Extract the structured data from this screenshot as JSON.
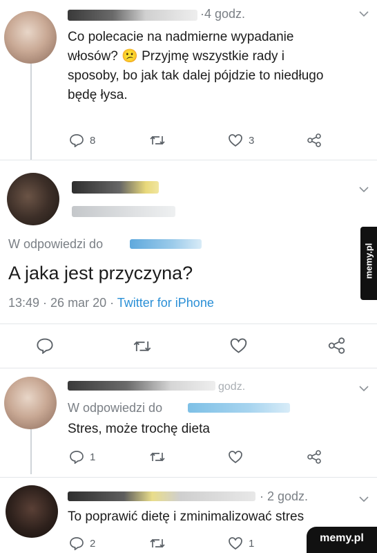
{
  "tweet1": {
    "time": "·4 godz.",
    "text_line1": "Co polecacie na nadmierne wypadanie",
    "text_line2a": "włosów?",
    "emoji": "😕",
    "text_line2b": "Przyjmę wszystkie rady i",
    "text_line3": "sposoby, bo jak tak dalej pójdzie to niedługo",
    "text_line4": "będę łysa.",
    "replies": "8",
    "likes": "3"
  },
  "tweet2": {
    "reply_to_label": "W odpowiedzi do",
    "text": "A jaka jest przyczyna?",
    "time": "13:49 · 26 mar 20 ·",
    "source": "Twitter for iPhone"
  },
  "tweet3": {
    "time": "godz.",
    "reply_to_label": "W odpowiedzi do",
    "text": "Stres, może trochę dieta",
    "replies": "1"
  },
  "tweet4": {
    "time": "· 2 godz.",
    "text": "To poprawić dietę i zminimalizować stres",
    "replies": "2",
    "likes": "1"
  },
  "watermark": {
    "side": "memy.pl",
    "corner": "memy.pl"
  },
  "colors": {
    "link": "#2a8fd6",
    "icon": "#5b6167",
    "thread_line": "#cfd4d9"
  }
}
